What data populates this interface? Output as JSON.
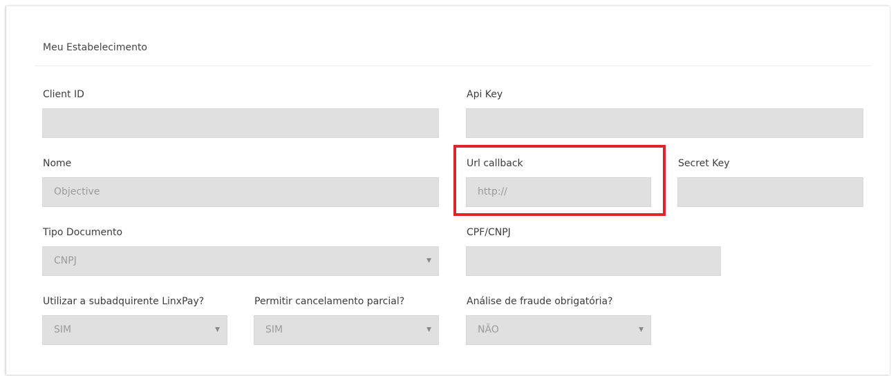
{
  "section_title": "Meu Estabelecimento",
  "fields": {
    "client_id": {
      "label": "Client ID",
      "value": ""
    },
    "api_key": {
      "label": "Api Key",
      "value": ""
    },
    "nome": {
      "label": "Nome",
      "value": "Objective"
    },
    "url_callback": {
      "label": "Url callback",
      "placeholder": "http://"
    },
    "secret_key": {
      "label": "Secret Key",
      "value": ""
    },
    "tipo_documento": {
      "label": "Tipo Documento",
      "value": "CNPJ"
    },
    "cpf_cnpj": {
      "label": "CPF/CNPJ",
      "value": ""
    },
    "subadquirente": {
      "label": "Utilizar a subadquirente LinxPay?",
      "value": "SIM"
    },
    "cancelamento_parcial": {
      "label": "Permitir cancelamento parcial?",
      "value": "SIM"
    },
    "analise_fraude": {
      "label": "Análise de fraude obrigatória?",
      "value": "NÃO"
    }
  },
  "icons": {
    "select_arrow": "▼"
  },
  "colors": {
    "highlight": "#e0242d",
    "field_bg": "#e0e0e0"
  }
}
